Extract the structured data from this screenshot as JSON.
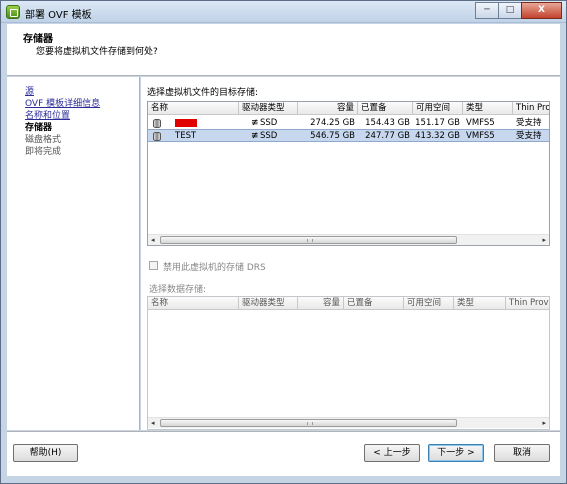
{
  "window": {
    "title": "部署 OVF 模板",
    "min": "─",
    "max": "□",
    "close": "X"
  },
  "header": {
    "title": "存储器",
    "subtitle": "您要将虚拟机文件存储到何处?"
  },
  "nav": [
    {
      "label": "源",
      "state": "link"
    },
    {
      "label": "OVF 模板详细信息",
      "state": "link"
    },
    {
      "label": "名称和位置",
      "state": "link"
    },
    {
      "label": "存储器",
      "state": "current"
    },
    {
      "label": "磁盘格式",
      "state": "pending"
    },
    {
      "label": "即将完成",
      "state": "pending"
    }
  ],
  "storage": {
    "label": "选择虚拟机文件的目标存储:",
    "columns": [
      "名称",
      "驱动器类型",
      "容量",
      "已置备",
      "可用空间",
      "类型",
      "Thin Provi"
    ],
    "rows": [
      {
        "name": "",
        "name_redacted": true,
        "drive_icon": "ssd-icon",
        "drive": "SSD",
        "capacity": "274.25 GB",
        "provisioned": "154.43 GB",
        "free": "151.17 GB",
        "type": "VMFS5",
        "thin": "受支持",
        "selected": false
      },
      {
        "name": "TEST",
        "name_redacted": false,
        "drive_icon": "ssd-icon",
        "drive": "SSD",
        "capacity": "546.75 GB",
        "provisioned": "247.77 GB",
        "free": "413.32 GB",
        "type": "VMFS5",
        "thin": "受支持",
        "selected": true
      }
    ]
  },
  "drs": {
    "label": "禁用此虚拟机的存储 DRS",
    "checked": false
  },
  "datastore": {
    "label": "选择数据存储:",
    "columns": [
      "名称",
      "驱动器类型",
      "容量",
      "已置备",
      "可用空间",
      "类型",
      "Thin Provi"
    ]
  },
  "buttons": {
    "help": "帮助(H)",
    "back": "< 上一步",
    "next": "下一步 >",
    "cancel": "取消"
  },
  "scroll_arrows": {
    "left": "◂",
    "right": "▸"
  },
  "colors": {
    "selection": "#c6d7ee",
    "redaction": "#e00000",
    "link": "#2b2b9a"
  }
}
